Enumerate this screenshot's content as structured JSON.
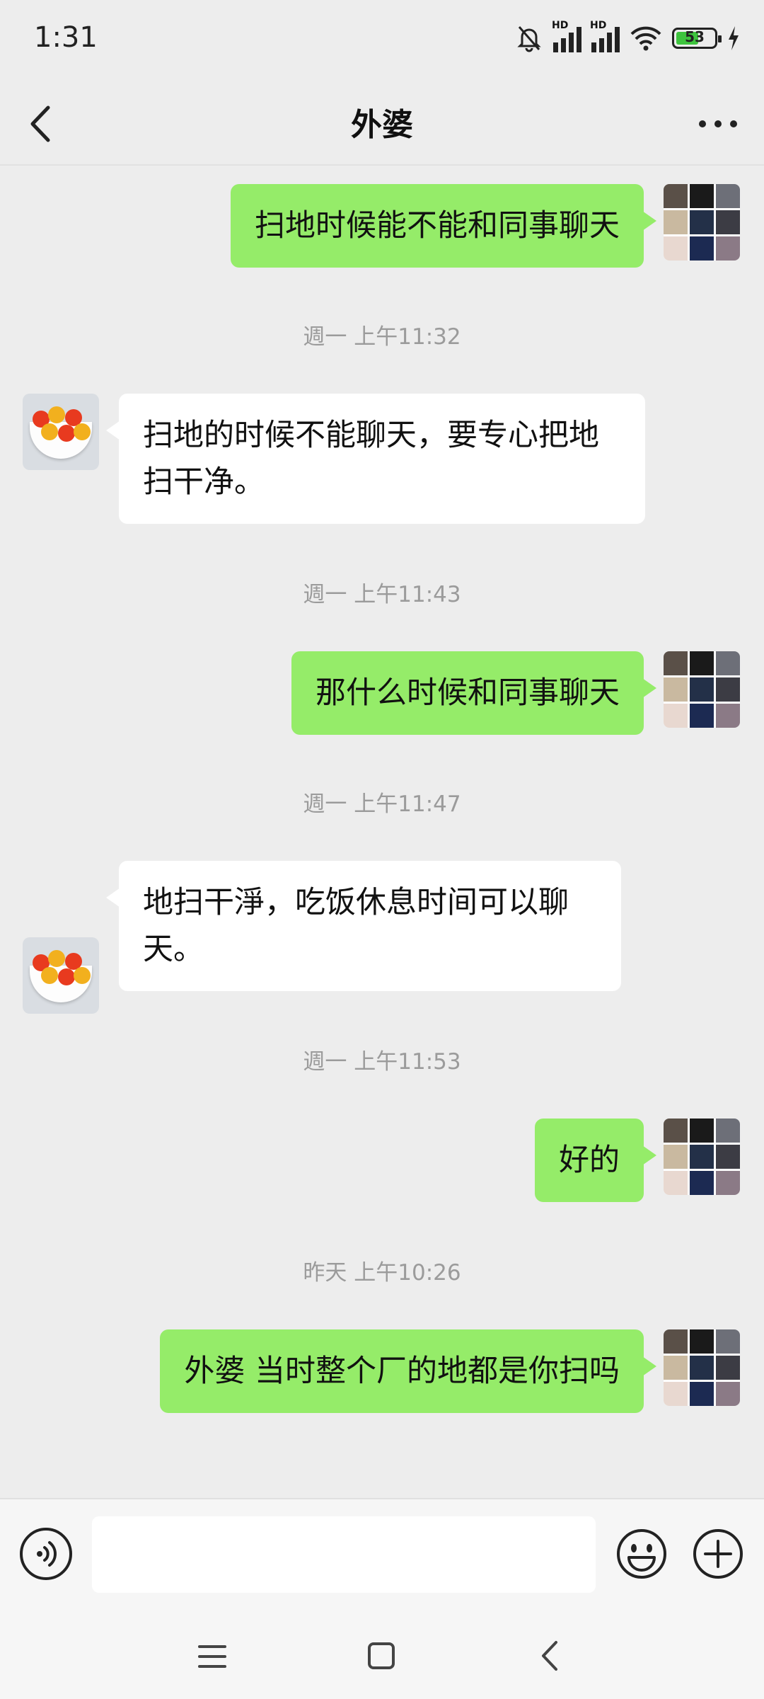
{
  "status_bar": {
    "time": "1:31",
    "battery": "53",
    "battery_level": 0.53,
    "signal_label": "HD"
  },
  "header": {
    "title": "外婆"
  },
  "messages": [
    {
      "type": "me",
      "text": "扫地时候能不能和同事聊天"
    },
    {
      "type": "timestamp",
      "text": "週一 上午11:32"
    },
    {
      "type": "other",
      "text": "扫地的时候不能聊天，要专心把地扫干净。"
    },
    {
      "type": "timestamp",
      "text": "週一 上午11:43"
    },
    {
      "type": "me",
      "text": "那什么时候和同事聊天"
    },
    {
      "type": "timestamp",
      "text": "週一 上午11:47"
    },
    {
      "type": "other",
      "text": "地扫干淨，吃饭休息时间可以聊天。"
    },
    {
      "type": "timestamp",
      "text": "週一 上午11:53"
    },
    {
      "type": "me",
      "text": "好的"
    },
    {
      "type": "timestamp",
      "text": "昨天 上午10:26"
    },
    {
      "type": "me",
      "text": "外婆 当时整个厂的地都是你扫吗"
    }
  ],
  "input": {
    "value": "",
    "placeholder": ""
  },
  "icons": {
    "back": "chevron-left-icon",
    "more": "more-dots-icon",
    "voice": "voice-icon",
    "emoji": "emoji-icon",
    "plus": "plus-icon",
    "nav_menu": "menu-icon",
    "nav_home": "home-icon",
    "nav_back": "back-icon"
  },
  "colors": {
    "me_bubble": "#95ec69",
    "other_bubble": "#ffffff",
    "background": "#ededed",
    "timestamp": "#9b9b9b"
  }
}
